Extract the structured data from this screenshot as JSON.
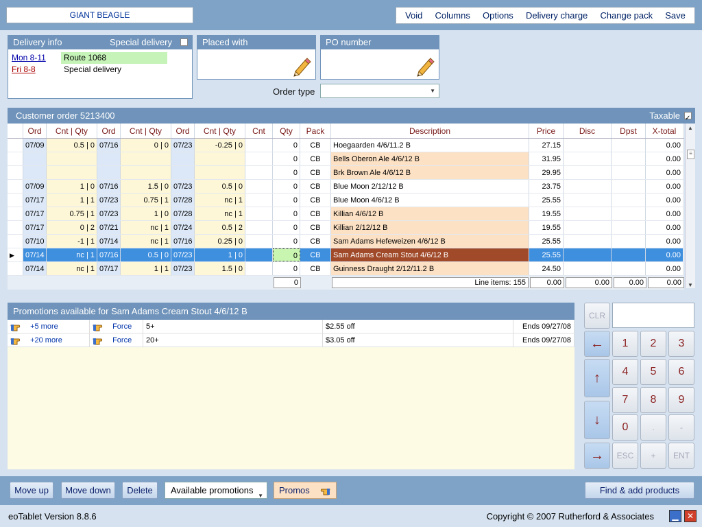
{
  "customer_name": "GIANT BEAGLE",
  "top_menu": [
    "Void",
    "Columns",
    "Options",
    "Delivery charge",
    "Change pack",
    "Save"
  ],
  "delivery_info": {
    "title": "Delivery info",
    "special_label": "Special delivery",
    "rows": [
      {
        "day": "Mon 8-11",
        "route": "Route 1068"
      },
      {
        "day": "Fri 8-8",
        "route": "Special delivery"
      }
    ]
  },
  "placed_with": {
    "title": "Placed with"
  },
  "po_number": {
    "title": "PO number"
  },
  "order_type": {
    "label": "Order type",
    "value": ""
  },
  "order": {
    "title": "Customer order 5213400",
    "taxable_label": "Taxable",
    "columns": [
      "Ord",
      "Cnt | Qty",
      "Ord",
      "Cnt | Qty",
      "Ord",
      "Cnt | Qty",
      "Cnt",
      "Qty",
      "Pack",
      "Description",
      "Price",
      "Disc",
      "Dpst",
      "X-total"
    ],
    "rows": [
      {
        "o1": "07/09",
        "c1": "0.5 | 0",
        "o2": "07/16",
        "c2": "0 | 0",
        "o3": "07/23",
        "c3": "-0.25 | 0",
        "cnt": "",
        "qty": "0",
        "pack": "CB",
        "desc": "Hoegaarden 4/6/11.2 B",
        "price": "27.15",
        "disc": "",
        "dpst": "",
        "xt": "0.00"
      },
      {
        "o1": "",
        "c1": "",
        "o2": "",
        "c2": "",
        "o3": "",
        "c3": "",
        "cnt": "",
        "qty": "0",
        "pack": "CB",
        "desc": "Bells Oberon Ale 4/6/12 B",
        "price": "31.95",
        "disc": "",
        "dpst": "",
        "xt": "0.00"
      },
      {
        "o1": "",
        "c1": "",
        "o2": "",
        "c2": "",
        "o3": "",
        "c3": "",
        "cnt": "",
        "qty": "0",
        "pack": "CB",
        "desc": "Brk Brown Ale 4/6/12 B",
        "price": "29.95",
        "disc": "",
        "dpst": "",
        "xt": "0.00"
      },
      {
        "o1": "07/09",
        "c1": "1 | 0",
        "o2": "07/16",
        "c2": "1.5 | 0",
        "o3": "07/23",
        "c3": "0.5 | 0",
        "cnt": "",
        "qty": "0",
        "pack": "CB",
        "desc": "Blue Moon 2/12/12 B",
        "price": "23.75",
        "disc": "",
        "dpst": "",
        "xt": "0.00"
      },
      {
        "o1": "07/17",
        "c1": "1 | 1",
        "o2": "07/23",
        "c2": "0.75 | 1",
        "o3": "07/28",
        "c3": "nc | 1",
        "cnt": "",
        "qty": "0",
        "pack": "CB",
        "desc": "Blue Moon 4/6/12 B",
        "price": "25.55",
        "disc": "",
        "dpst": "",
        "xt": "0.00"
      },
      {
        "o1": "07/17",
        "c1": "0.75 | 1",
        "o2": "07/23",
        "c2": "1 | 0",
        "o3": "07/28",
        "c3": "nc | 1",
        "cnt": "",
        "qty": "0",
        "pack": "CB",
        "desc": "Killian 4/6/12 B",
        "price": "19.55",
        "disc": "",
        "dpst": "",
        "xt": "0.00"
      },
      {
        "o1": "07/17",
        "c1": "0 | 2",
        "o2": "07/21",
        "c2": "nc | 1",
        "o3": "07/24",
        "c3": "0.5 | 2",
        "cnt": "",
        "qty": "0",
        "pack": "CB",
        "desc": "Killian 2/12/12 B",
        "price": "19.55",
        "disc": "",
        "dpst": "",
        "xt": "0.00"
      },
      {
        "o1": "07/10",
        "c1": "-1 | 1",
        "o2": "07/14",
        "c2": "nc | 1",
        "o3": "07/16",
        "c3": "0.25 | 0",
        "cnt": "",
        "qty": "0",
        "pack": "CB",
        "desc": "Sam Adams Hefeweizen 4/6/12 B",
        "price": "25.55",
        "disc": "",
        "dpst": "",
        "xt": "0.00"
      },
      {
        "o1": "07/14",
        "c1": "nc | 1",
        "o2": "07/16",
        "c2": "0.5 | 0",
        "o3": "07/23",
        "c3": "1 | 0",
        "cnt": "",
        "qty": "0",
        "pack": "CB",
        "desc": "Sam Adams Cream Stout 4/6/12 B",
        "price": "25.55",
        "disc": "",
        "dpst": "",
        "xt": "0.00"
      },
      {
        "o1": "07/14",
        "c1": "nc | 1",
        "o2": "07/17",
        "c2": "1 | 1",
        "o3": "07/23",
        "c3": "1.5 | 0",
        "cnt": "",
        "qty": "0",
        "pack": "CB",
        "desc": "Guinness Draught 2/12/11.2 B",
        "price": "24.50",
        "disc": "",
        "dpst": "",
        "xt": "0.00"
      }
    ],
    "footer": {
      "qty_total": "0",
      "line_items_label": "Line items:",
      "line_items": "155",
      "price_total": "0.00",
      "disc_total": "0.00",
      "dpst_total": "0.00",
      "xt_total": "0.00"
    }
  },
  "promotions": {
    "title": "Promotions available for Sam Adams Cream Stout 4/6/12 B",
    "rows": [
      {
        "link": "+5 more",
        "force": "Force",
        "min": "5+",
        "off": "$2.55 off",
        "ends": "Ends 09/27/08"
      },
      {
        "link": "+20 more",
        "force": "Force",
        "min": "20+",
        "off": "$3.05 off",
        "ends": "Ends 09/27/08"
      }
    ]
  },
  "keypad": {
    "clr": "CLR",
    "display": "",
    "keys": [
      "1",
      "2",
      "3",
      "4",
      "5",
      "6",
      "7",
      "8",
      "9",
      "0",
      ".",
      "-",
      "ESC",
      "+",
      "ENT"
    ],
    "left": "←",
    "up": "↑",
    "down": "↓",
    "right": "→"
  },
  "bottom": {
    "move_up": "Move up",
    "move_down": "Move down",
    "delete": "Delete",
    "available_promotions": "Available promotions",
    "promos": "Promos",
    "find_add": "Find & add products"
  },
  "status": {
    "version": "eoTablet Version 8.8.6",
    "copyright": "Copyright © 2007 Rutherford & Associates"
  },
  "colors": {
    "header": "#6f93ba",
    "selected_row": "#3f8fdf",
    "selected_desc": "#a04a2a",
    "route_green": "#c6f3b8"
  }
}
